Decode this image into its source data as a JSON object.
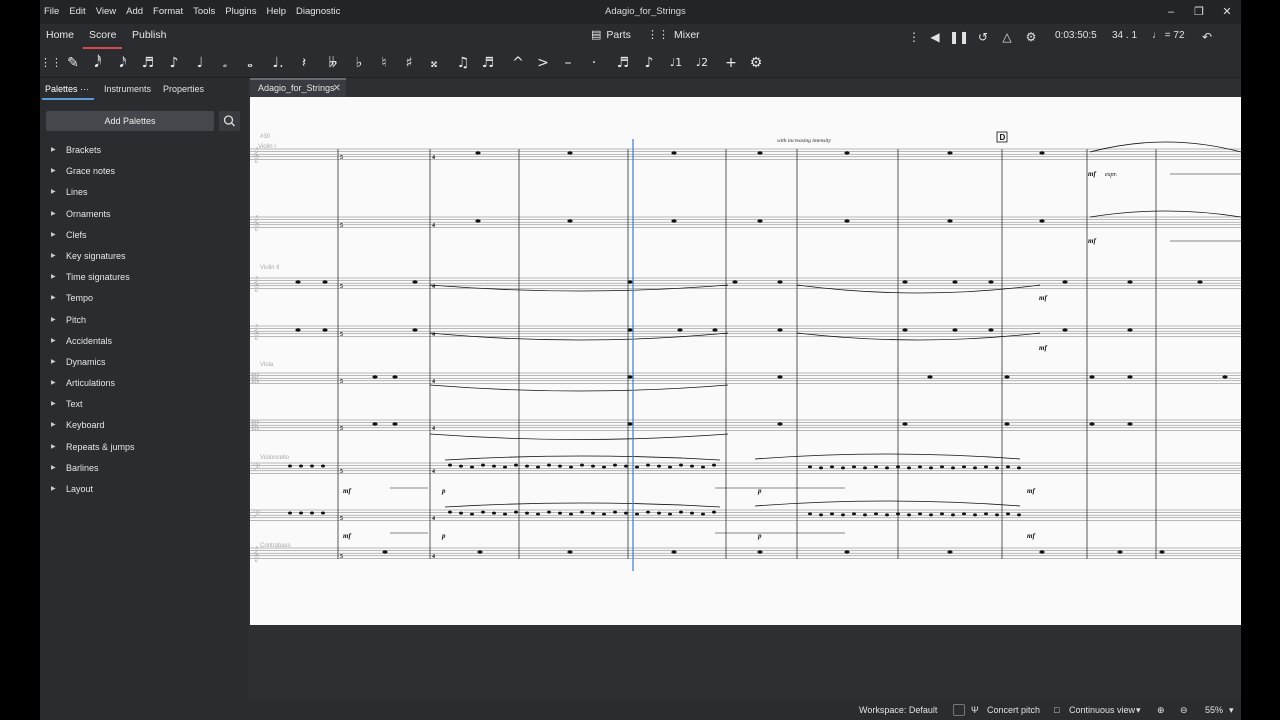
{
  "menu": [
    "File",
    "Edit",
    "View",
    "Add",
    "Format",
    "Tools",
    "Plugins",
    "Help",
    "Diagnostic"
  ],
  "window_title": "Adagio_for_Strings",
  "window_controls": [
    "minimize-icon",
    "restore-icon",
    "close-icon"
  ],
  "tabs": {
    "home": "Home",
    "score": "Score",
    "publish": "Publish"
  },
  "center": {
    "parts": "Parts",
    "mixer": "Mixer"
  },
  "playback": {
    "time": "0:03:50:5",
    "position": "34 . 1",
    "tempo": "♩ = 72"
  },
  "toolbar_icons": [
    "drag-handle-icon",
    "pen-icon",
    "64th-note-icon",
    "32nd-note-icon",
    "16th-note-icon",
    "eighth-note-icon",
    "quarter-note-icon",
    "half-note-icon",
    "whole-note-icon",
    "augmentation-dot-icon",
    "rest-icon",
    "double-flat-icon",
    "flat-icon",
    "natural-icon",
    "sharp-icon",
    "double-sharp-icon",
    "tie-icon",
    "slur-icon",
    "marcato-icon",
    "accent-icon",
    "tenuto-icon",
    "staccato-icon",
    "tuplet-icon",
    "flip-icon",
    "voice-1-icon",
    "voice-2-icon",
    "add-icon",
    "toolbar-settings-icon"
  ],
  "panel": {
    "tabs": {
      "palettes": "Palettes",
      "more": "···",
      "instruments": "Instruments",
      "properties": "Properties"
    },
    "add_palettes": "Add Palettes",
    "palettes": [
      "Brackets",
      "Grace notes",
      "Lines",
      "Ornaments",
      "Clefs",
      "Key signatures",
      "Time signatures",
      "Tempo",
      "Pitch",
      "Accidentals",
      "Dynamics",
      "Articulations",
      "Text",
      "Keyboard",
      "Repeats & jumps",
      "Barlines",
      "Layout"
    ]
  },
  "document_tab": "Adagio_for_Strings",
  "score": {
    "measure_number": "#30",
    "rehearsal_mark": "D",
    "tempo_text": "with increasing intensity",
    "staff_labels": {
      "violin1": "Violin I",
      "violin2": "Violin II",
      "viola": "Viola",
      "cello": "Violoncello",
      "bass": "Contrabass"
    },
    "dynamics": {
      "mf": "mf",
      "p": "p",
      "espr": "espr."
    }
  },
  "status": {
    "workspace": "Workspace: Default",
    "concert_pitch": "Concert pitch",
    "view_mode": "Continuous view",
    "zoom": "55%"
  }
}
